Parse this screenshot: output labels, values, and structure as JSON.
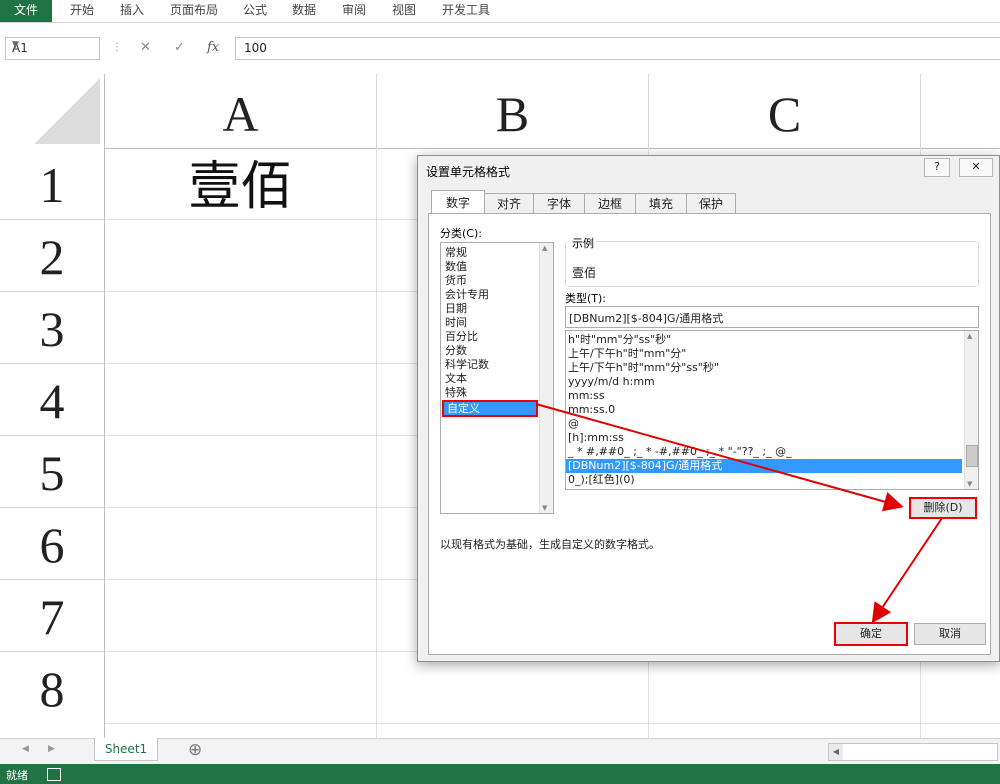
{
  "ribbon": {
    "tabs": [
      "文件",
      "开始",
      "插入",
      "页面布局",
      "公式",
      "数据",
      "审阅",
      "视图",
      "开发工具"
    ]
  },
  "formula_bar": {
    "name_box": "A1",
    "cancel_icon": "✕",
    "enter_icon": "✓",
    "fx_label": "fx",
    "value": "100"
  },
  "sheet": {
    "columns": [
      "A",
      "B",
      "C"
    ],
    "rows": [
      "1",
      "2",
      "3",
      "4",
      "5",
      "6",
      "7",
      "8"
    ],
    "cell_a1": "壹佰"
  },
  "sheet_tabs": {
    "active": "Sheet1",
    "add_icon": "⊕"
  },
  "status": {
    "text": "就绪"
  },
  "dialog": {
    "title": "设置单元格格式",
    "help_btn": "?",
    "close_btn": "✕",
    "tabs": [
      "数字",
      "对齐",
      "字体",
      "边框",
      "填充",
      "保护"
    ],
    "category_label": "分类(C):",
    "categories": [
      "常规",
      "数值",
      "货币",
      "会计专用",
      "日期",
      "时间",
      "百分比",
      "分数",
      "科学记数",
      "文本",
      "特殊",
      "自定义"
    ],
    "selected_category": "自定义",
    "sample_label": "示例",
    "sample_value": "壹佰",
    "type_label": "类型(T):",
    "type_value": "[DBNum2][$-804]G/通用格式",
    "type_list": [
      "h\"时\"mm\"分\"ss\"秒\"",
      "上午/下午h\"时\"mm\"分\"",
      "上午/下午h\"时\"mm\"分\"ss\"秒\"",
      "yyyy/m/d h:mm",
      "mm:ss",
      "mm:ss.0",
      "@",
      "[h]:mm:ss",
      "_ * #,##0_ ;_ * -#,##0_ ;_ * \"-\"??_ ;_ @_",
      "[DBNum2][$-804]G/通用格式",
      "0_);[红色](0)"
    ],
    "selected_type": "[DBNum2][$-804]G/通用格式",
    "delete_btn": "删除(D)",
    "note": "以现有格式为基础，生成自定义的数字格式。",
    "ok_btn": "确定",
    "cancel_btn": "取消"
  },
  "colors": {
    "excel_green": "#217346",
    "selection_blue": "#3399ff",
    "annotation_red": "#e00000"
  }
}
